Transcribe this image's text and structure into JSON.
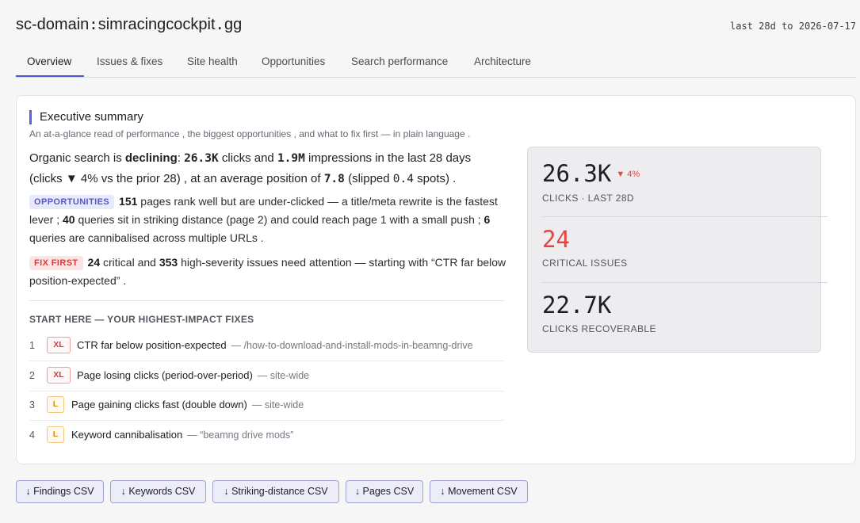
{
  "header": {
    "domain_prefix": "sc-domain",
    "domain_sep": ":",
    "domain_name": "simracingcockpit",
    "domain_dot": ".",
    "domain_tld": "gg",
    "date_range": "last 28d to 2026-07-17"
  },
  "tabs": [
    {
      "label": "Overview",
      "active": true
    },
    {
      "label": "Issues & fixes",
      "active": false
    },
    {
      "label": "Site health",
      "active": false
    },
    {
      "label": "Opportunities",
      "active": false
    },
    {
      "label": "Search performance",
      "active": false
    },
    {
      "label": "Architecture",
      "active": false
    }
  ],
  "summary": {
    "title": "Executive summary",
    "subtitle": "An at-a-glance read of performance , the biggest opportunities , and what to fix first — in plain language .",
    "lead": {
      "t1": "Organic search is ",
      "trend": "declining",
      "t2": ": ",
      "clicks": "26.3K",
      "t3": " clicks and ",
      "impressions": "1.9M",
      "t4": " impressions in the last 28 days (clicks ",
      "arrow": "▼",
      "t5": " 4% vs the prior 28) , at an average position of ",
      "position": "7.8",
      "t6": " (slipped ",
      "slip": "0.4",
      "t7": " spots) ."
    },
    "opportunities": {
      "badge": "OPPORTUNITIES",
      "n1": "151",
      "t1": " pages rank well but are under-clicked — a title/meta rewrite is the fastest lever ; ",
      "n2": "40",
      "t2": " queries sit in striking distance (page 2) and could reach page 1 with a small push ; ",
      "n3": "6",
      "t3": " queries are cannibalised across multiple URLs ."
    },
    "fix_first": {
      "badge": "FIX FIRST",
      "n1": "24",
      "t1": " critical and ",
      "n2": "353",
      "t2": " high-severity issues need attention — starting with “CTR far below position-expected” ."
    },
    "start_here": "START HERE — YOUR HIGHEST-IMPACT FIXES",
    "fixes": [
      {
        "index": "1",
        "severity": "XL",
        "title": "CTR far below position-expected",
        "context": "— /how-to-download-and-install-mods-in-beamng-drive"
      },
      {
        "index": "2",
        "severity": "XL",
        "title": "Page losing clicks (period-over-period)",
        "context": "— site-wide"
      },
      {
        "index": "3",
        "severity": "L",
        "title": "Page gaining clicks fast (double down)",
        "context": "— site-wide"
      },
      {
        "index": "4",
        "severity": "L",
        "title": "Keyword cannibalisation",
        "context": "— “beamng drive mods”"
      }
    ]
  },
  "kpis": [
    {
      "value": "26.3K",
      "delta": "▼ 4%",
      "label": "CLICKS · LAST 28D"
    },
    {
      "value": "24",
      "label": "CRITICAL ISSUES"
    },
    {
      "value": "22.7K",
      "label": "CLICKS RECOVERABLE"
    }
  ],
  "downloads": [
    "↓ Findings CSV",
    "↓ Keywords CSV",
    "↓ Striking-distance CSV",
    "↓ Pages CSV",
    "↓ Movement CSV"
  ],
  "colors": {
    "accent": "#5a5fe0",
    "critical": "#e14545",
    "warning": "#d48b18"
  }
}
